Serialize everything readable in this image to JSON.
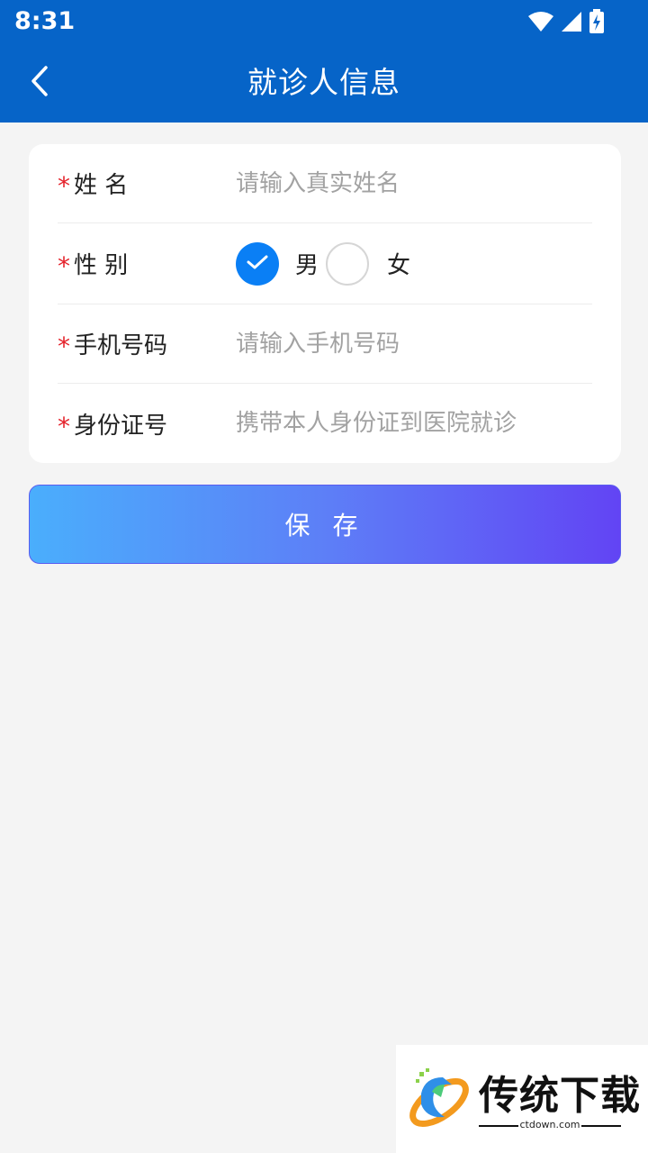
{
  "status_bar": {
    "time": "8:31"
  },
  "header": {
    "title": "就诊人信息"
  },
  "form": {
    "name": {
      "label": "姓 名",
      "placeholder": "请输入真实姓名",
      "required_mark": "*"
    },
    "gender": {
      "label": "性 别",
      "required_mark": "*",
      "options": [
        {
          "label": "男",
          "selected": true
        },
        {
          "label": "女",
          "selected": false
        }
      ]
    },
    "phone": {
      "label": "手机号码",
      "placeholder": "请输入手机号码",
      "required_mark": "*"
    },
    "id_card": {
      "label": "身份证号",
      "placeholder": "携带本人身份证到医院就诊",
      "required_mark": "*"
    }
  },
  "save_button": {
    "label": "保 存"
  },
  "watermark": {
    "brand": "传统下载",
    "url": "ctdown.com"
  },
  "colors": {
    "primary": "#0664c8",
    "accent": "#0a7ff5",
    "required": "#e5232c"
  }
}
